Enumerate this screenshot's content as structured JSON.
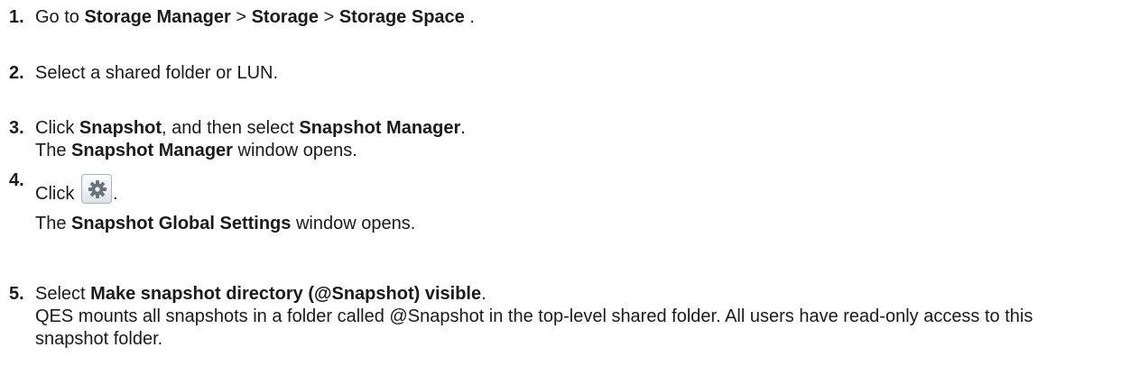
{
  "steps": [
    {
      "number": "1.",
      "go_to": "Go to",
      "path": [
        "Storage Manager",
        "Storage",
        "Storage Space"
      ],
      "separator": ">",
      "end": "."
    },
    {
      "number": "2.",
      "text": "Select a shared folder or LUN."
    },
    {
      "number": "3.",
      "click": "Click",
      "button": "Snapshot",
      "middle": ", and then select",
      "menu_item": "Snapshot Manager",
      "end": ".",
      "result_prefix": "The",
      "result_window": "Snapshot Manager",
      "result_suffix": "window opens."
    },
    {
      "number": "4.",
      "click": "Click",
      "icon": "gear-icon",
      "end": ".",
      "result_prefix": "The",
      "result_window": "Snapshot Global Settings",
      "result_suffix": "window opens."
    },
    {
      "number": "5.",
      "select": "Select",
      "option": "Make snapshot directory (@Snapshot) visible",
      "end": ".",
      "description": "QES mounts all snapshots in a folder called @Snapshot in the top-level shared folder. All users have read-only access to this snapshot folder."
    }
  ],
  "colors": {
    "text": "#1a1a1a",
    "gear_icon": "#6a737c"
  }
}
